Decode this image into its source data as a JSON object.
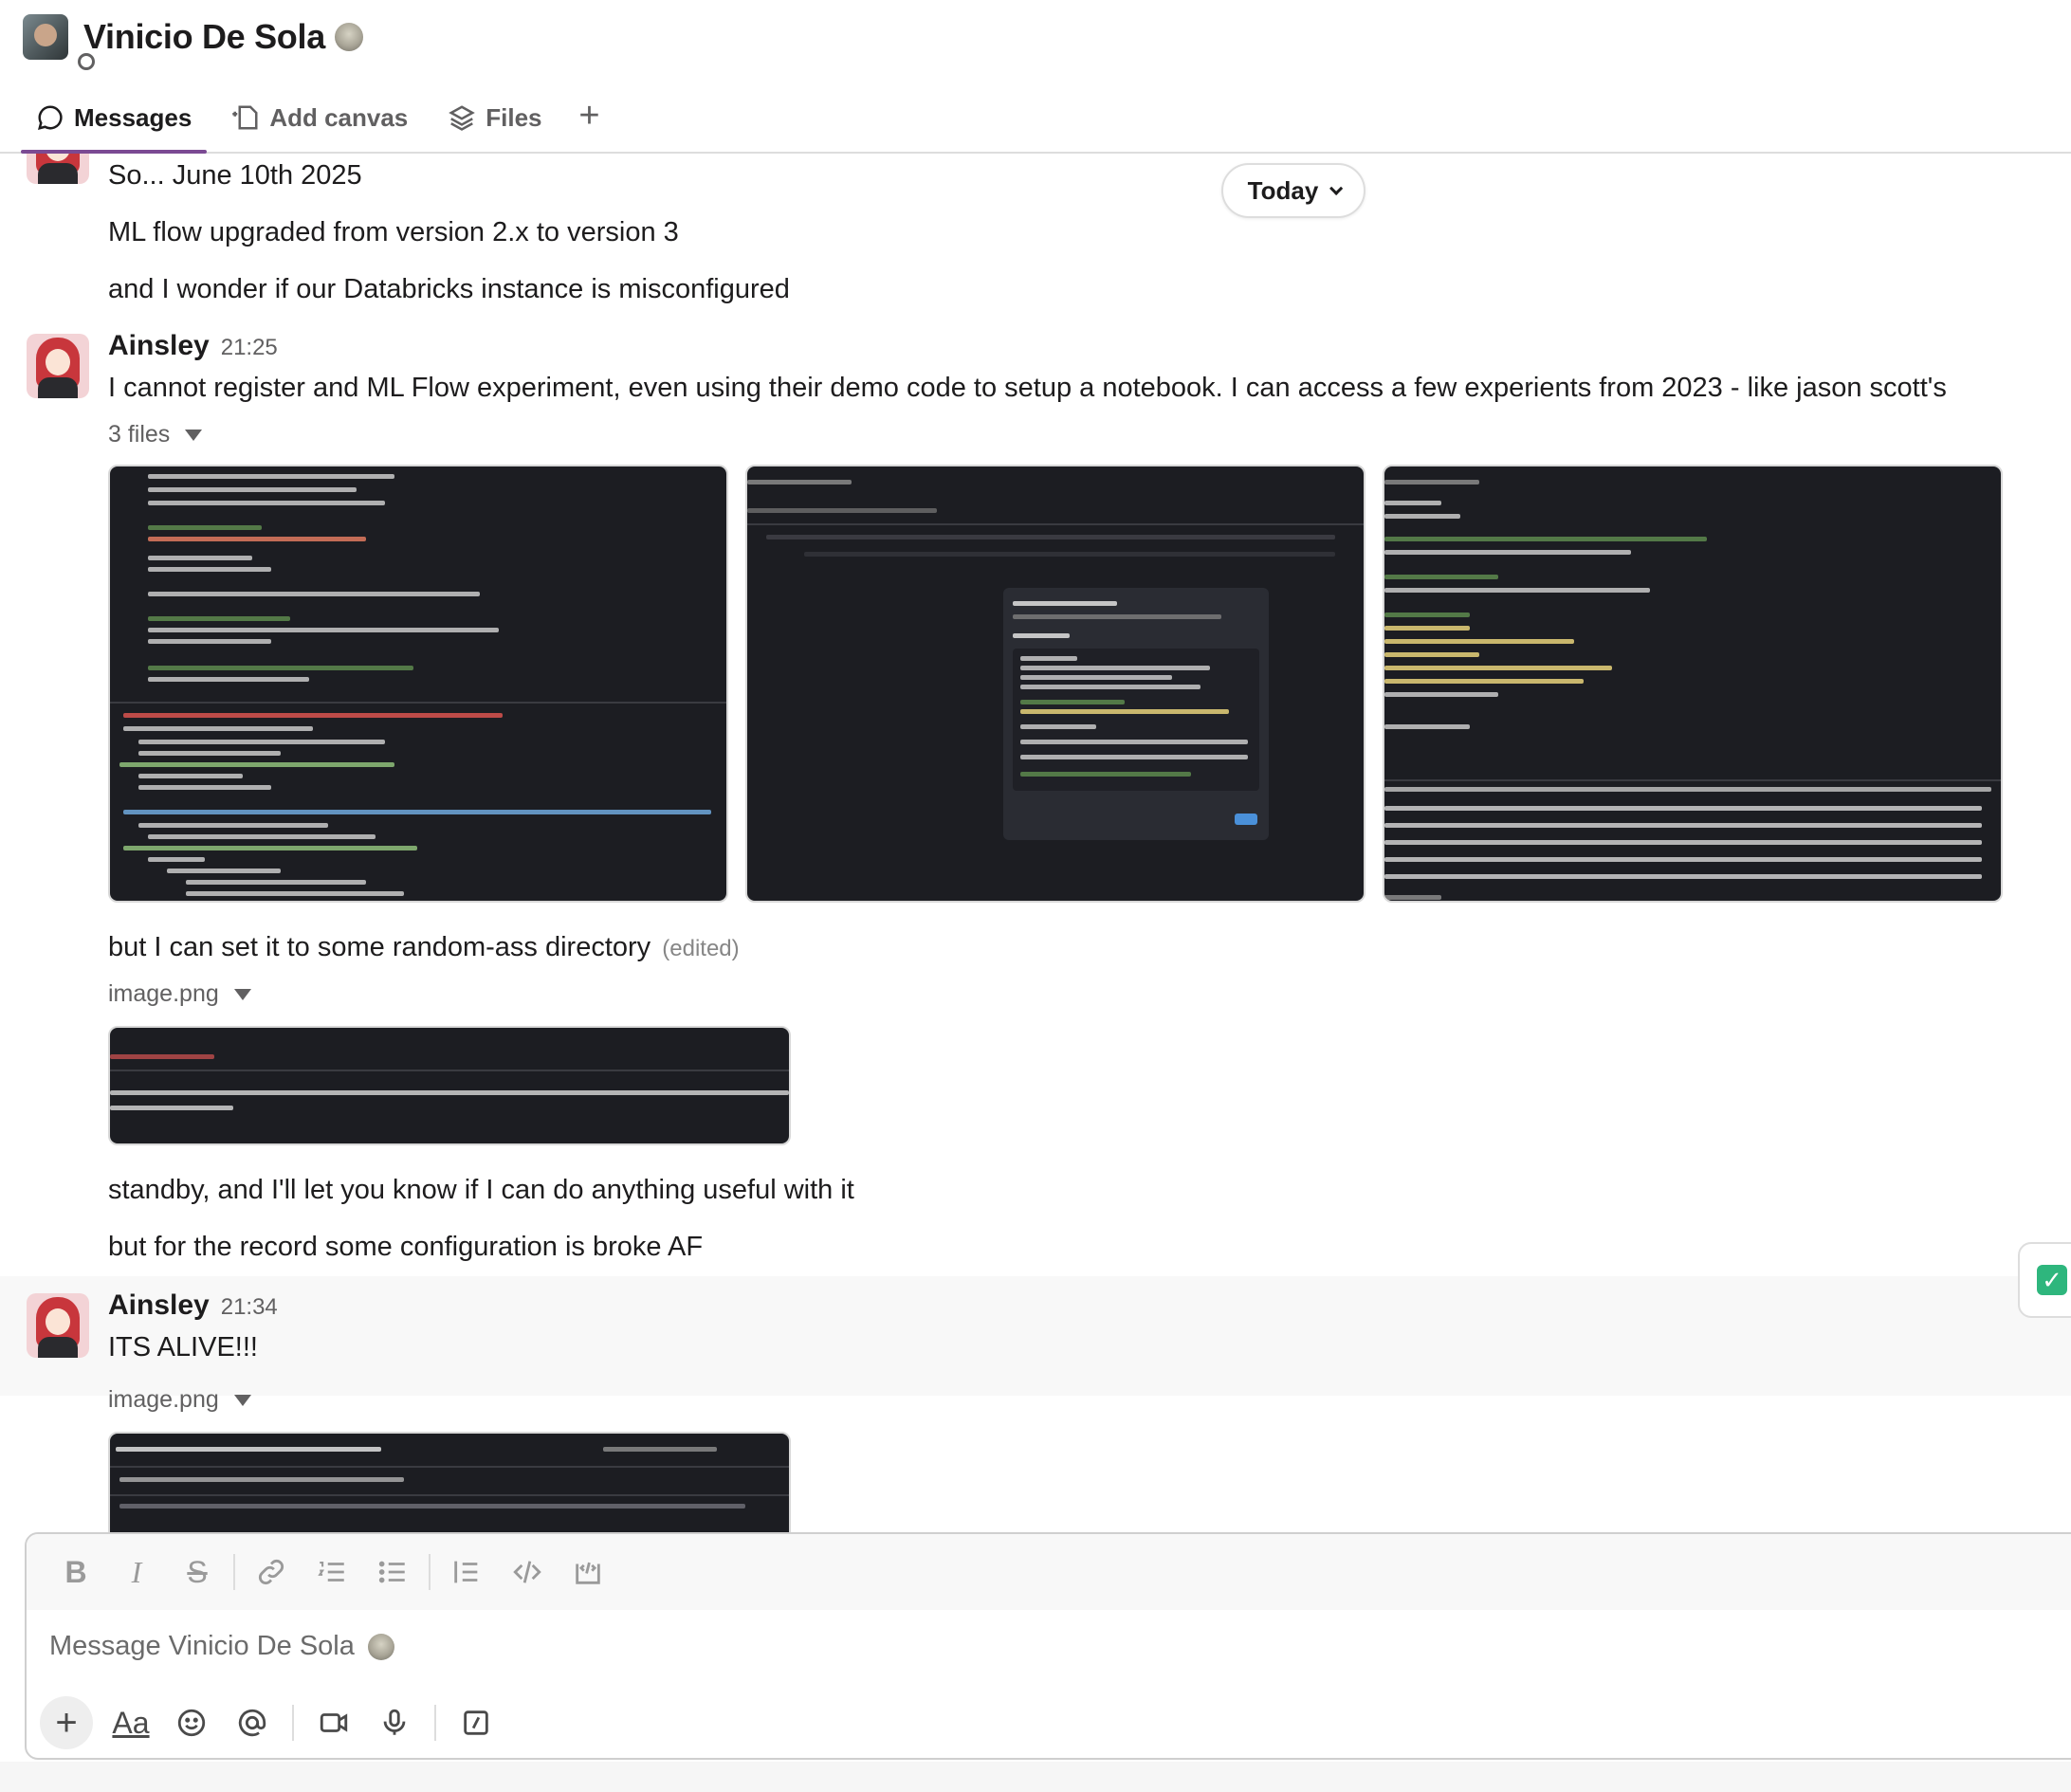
{
  "header": {
    "name": "Vinicio De Sola",
    "tabs": [
      {
        "label": "Messages",
        "icon": "message-icon",
        "active": true
      },
      {
        "label": "Add canvas",
        "icon": "canvas-icon",
        "active": false
      },
      {
        "label": "Files",
        "icon": "files-icon",
        "active": false
      }
    ]
  },
  "date_pill": {
    "label": "Today"
  },
  "messages": {
    "block1": [
      "So... June 10th 2025",
      "ML flow upgraded from version 2.x to version 3",
      "and I wonder if our Databricks instance is misconfigured"
    ],
    "msg2": {
      "sender": "Ainsley",
      "time": "21:25",
      "text": "I cannot register and ML Flow experiment, even using their demo code to setup a notebook. I can access a few experients from 2023 - like jason scott's",
      "files_label": "3 files"
    },
    "followups": {
      "random_dir": "but I can set it to some random-ass directory",
      "edited": "(edited)",
      "image_label": "image.png",
      "standby": "standby, and I'll let you know if I can do anything useful with it",
      "broke": "but for the record some configuration is broke AF"
    },
    "msg3": {
      "sender": "Ainsley",
      "time": "21:34",
      "text": "ITS ALIVE!!!",
      "image_label": "image.png"
    }
  },
  "reaction": {
    "emoji": "✅"
  },
  "composer": {
    "placeholder": "Message Vinicio De Sola",
    "format_buttons": [
      "bold-icon",
      "italic-icon",
      "strikethrough-icon",
      "link-icon",
      "ordered-list-icon",
      "bulleted-list-icon",
      "blockquote-icon",
      "code-icon",
      "code-block-icon"
    ],
    "action_buttons": [
      "plus-icon",
      "formatting-icon",
      "emoji-icon",
      "mention-icon",
      "video-icon",
      "microphone-icon",
      "slash-command-icon"
    ]
  }
}
